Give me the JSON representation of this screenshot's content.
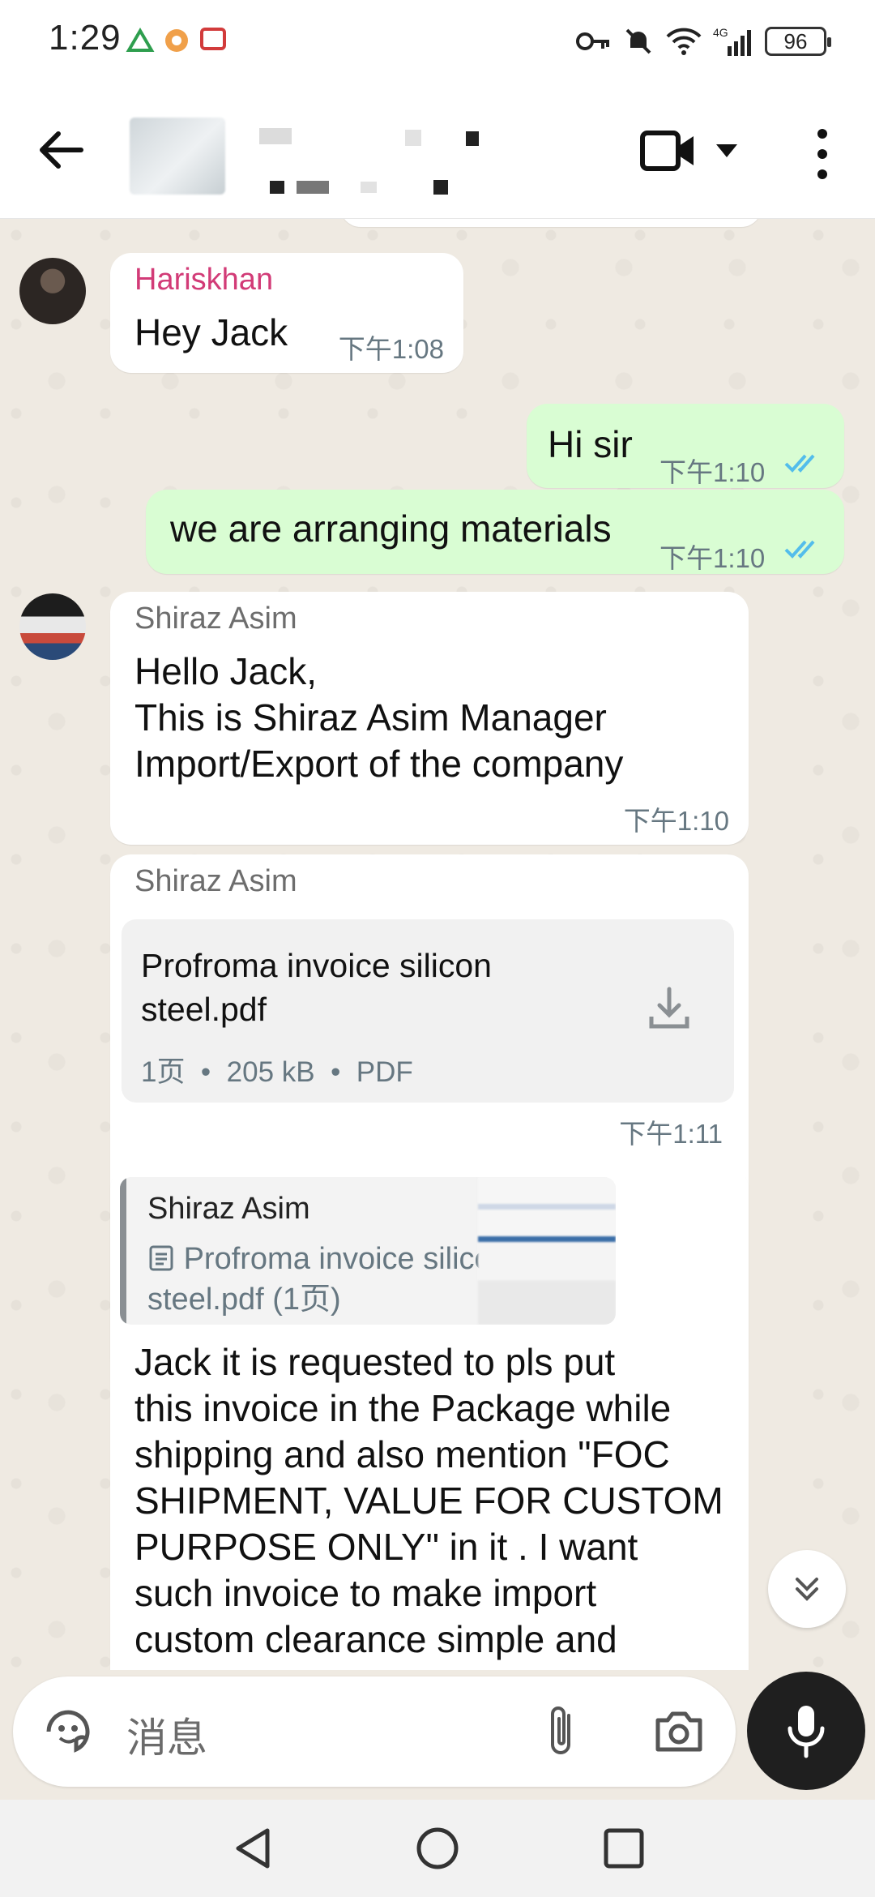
{
  "status_bar": {
    "time": "1:29",
    "battery": "96",
    "network": "4G"
  },
  "header": {
    "contact_name": "",
    "subtitle": ""
  },
  "messages": [
    {
      "sender": "Hariskhan",
      "text": "Hey Jack",
      "time": "下午1:08",
      "direction": "in"
    },
    {
      "text": "Hi sir",
      "time": "下午1:10",
      "direction": "out",
      "status": "read"
    },
    {
      "text": "we are arranging materials",
      "time": "下午1:10",
      "direction": "out",
      "status": "read"
    },
    {
      "sender": "Shiraz Asim",
      "lines": [
        "Hello Jack,",
        "This is Shiraz Asim Manager",
        "Import/Export of the company"
      ],
      "time": "下午1:10",
      "direction": "in"
    },
    {
      "sender": "Shiraz Asim",
      "doc_name_lines": [
        "Profroma invoice silicon",
        "steel.pdf"
      ],
      "doc_pages": "1页",
      "doc_size": "205 kB",
      "doc_type": "PDF",
      "time": "下午1:11",
      "direction": "in"
    },
    {
      "quote_sender": "Shiraz Asim",
      "quote_lines": [
        "Profroma invoice silicon",
        "steel.pdf (1页)"
      ],
      "lines": [
        "Jack it is requested to pls put",
        "this invoice in the Package while",
        "shipping and also mention \"FOC",
        "SHIPMENT, VALUE FOR CUSTOM",
        "PURPOSE ONLY\"  in it . I want",
        "such invoice to make import",
        "custom  clearance simple and"
      ],
      "direction": "in"
    }
  ],
  "composer": {
    "placeholder": "消息"
  },
  "icons": {
    "back": "arrow-left-icon",
    "video": "video-call-icon",
    "menu": "more-vertical-icon",
    "emoji": "sticker-icon",
    "attach": "paperclip-icon",
    "camera": "camera-icon",
    "mic": "microphone-icon",
    "download": "download-icon",
    "scroll": "double-chevron-down-icon"
  },
  "colors": {
    "incoming": "#ffffff",
    "outgoing": "#d9fdd3",
    "read_ticks": "#53bdeb",
    "sender_hariskhan": "#d23b77",
    "background": "#efeae2"
  }
}
